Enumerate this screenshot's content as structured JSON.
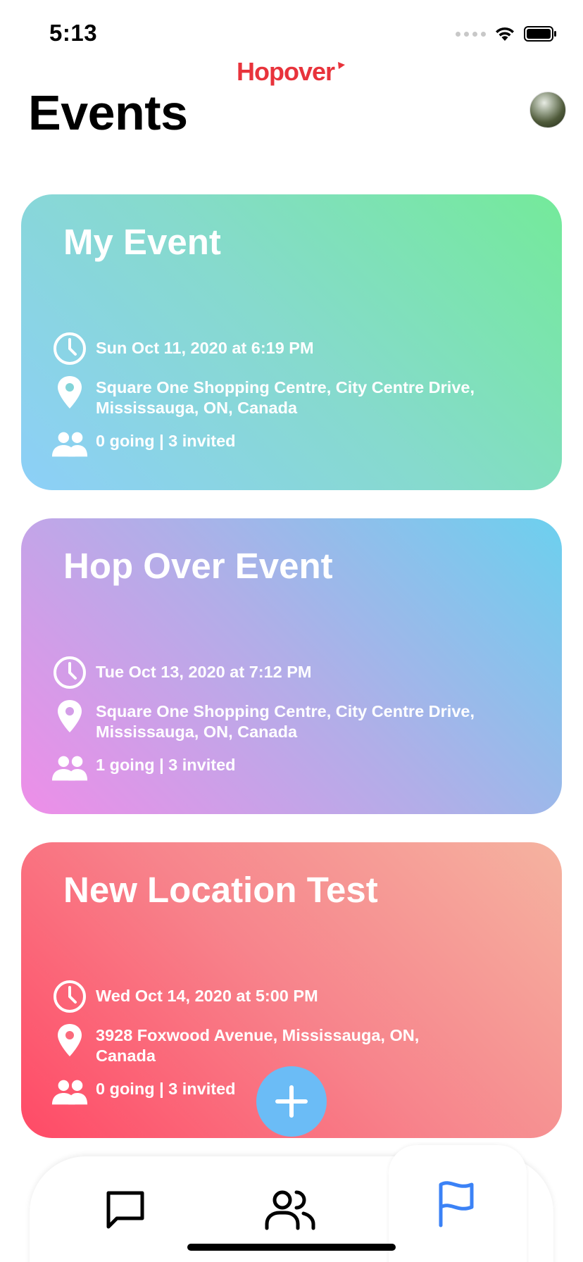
{
  "status_bar": {
    "time": "5:13"
  },
  "header": {
    "brand": "Hopover",
    "title": "Events"
  },
  "events": [
    {
      "title": "My Event",
      "datetime": "Sun Oct 11, 2020 at 6:19 PM",
      "location": "Square One Shopping Centre, City Centre Drive, Mississauga, ON, Canada",
      "attendance": "0 going | 3 invited"
    },
    {
      "title": "Hop Over Event",
      "datetime": "Tue Oct 13, 2020 at 7:12 PM",
      "location": "Square One Shopping Centre, City Centre Drive, Mississauga, ON, Canada",
      "attendance": "1 going | 3 invited"
    },
    {
      "title": "New Location Test",
      "datetime": "Wed Oct 14, 2020 at 5:00 PM",
      "location": "3928 Foxwood Avenue, Mississauga, ON, Canada",
      "attendance": "0 going | 3 invited"
    }
  ],
  "tabs": [
    {
      "icon": "chat-bubble-icon",
      "active": false
    },
    {
      "icon": "friends-icon",
      "active": false
    },
    {
      "icon": "flag-icon",
      "active": true
    }
  ],
  "colors": {
    "brand_red": "#e8333b",
    "active_tab": "#3b82f6",
    "fab": "#6bbcf6"
  }
}
